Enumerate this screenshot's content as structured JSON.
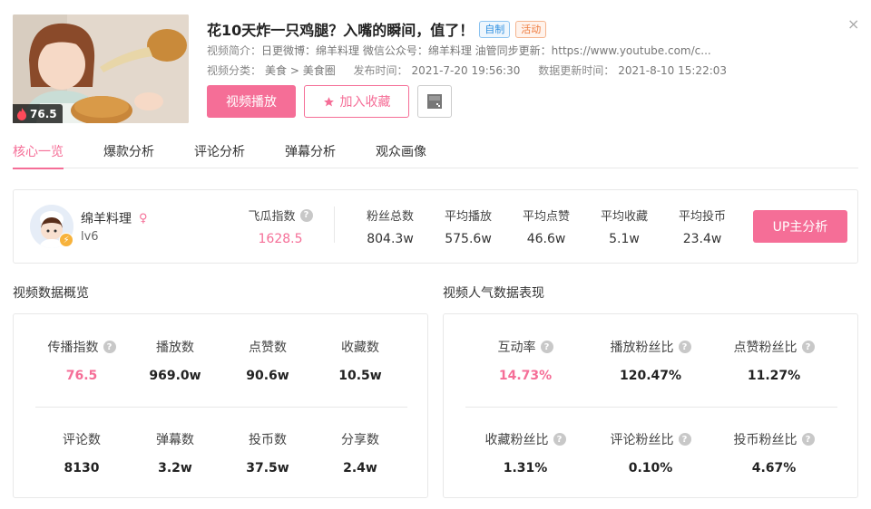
{
  "video": {
    "score": "76.5",
    "title": "花10天炸一只鸡腿？入嘴的瞬间，值了！",
    "tags": [
      "自制",
      "活动"
    ],
    "intro_label": "视频简介：",
    "intro_text": "日更微博：绵羊料理 微信公众号：绵羊料理 油管同步更新：https://www.youtube.com/c...",
    "category_label": "视频分类：",
    "category": "美食 > 美食圈",
    "publish_label": "发布时间：",
    "publish_time": "2021-7-20 19:56:30",
    "update_label": "数据更新时间：",
    "update_time": "2021-8-10 15:22:03",
    "play_button": "视频播放",
    "fav_button": "加入收藏",
    "close": "×"
  },
  "tabs": [
    "核心一览",
    "爆款分析",
    "评论分析",
    "弹幕分析",
    "观众画像"
  ],
  "up": {
    "name": "绵羊料理",
    "gender_symbol": "♀",
    "level": "lv6",
    "feigua_label": "飞瓜指数",
    "feigua_value": "1628.5",
    "stats": [
      {
        "label": "粉丝总数",
        "value": "804.3w"
      },
      {
        "label": "平均播放",
        "value": "575.6w"
      },
      {
        "label": "平均点赞",
        "value": "46.6w"
      },
      {
        "label": "平均收藏",
        "value": "5.1w"
      },
      {
        "label": "平均投币",
        "value": "23.4w"
      }
    ],
    "analyze_button": "UP主分析"
  },
  "overview": {
    "title": "视频数据概览",
    "row1": [
      {
        "label": "传播指数",
        "value": "76.5",
        "help": true,
        "pink": true
      },
      {
        "label": "播放数",
        "value": "969.0w"
      },
      {
        "label": "点赞数",
        "value": "90.6w"
      },
      {
        "label": "收藏数",
        "value": "10.5w"
      }
    ],
    "row2": [
      {
        "label": "评论数",
        "value": "8130"
      },
      {
        "label": "弹幕数",
        "value": "3.2w"
      },
      {
        "label": "投币数",
        "value": "37.5w"
      },
      {
        "label": "分享数",
        "value": "2.4w"
      }
    ]
  },
  "popularity": {
    "title": "视频人气数据表现",
    "row1": [
      {
        "label": "互动率",
        "value": "14.73%",
        "pink": true
      },
      {
        "label": "播放粉丝比",
        "value": "120.47%"
      },
      {
        "label": "点赞粉丝比",
        "value": "11.27%"
      }
    ],
    "row2": [
      {
        "label": "收藏粉丝比",
        "value": "1.31%"
      },
      {
        "label": "评论粉丝比",
        "value": "0.10%"
      },
      {
        "label": "投币粉丝比",
        "value": "4.67%"
      }
    ]
  },
  "colors": {
    "accent": "#f56e97",
    "tag_blue": "#2e8fe0",
    "tag_orange": "#ee7a3c"
  }
}
